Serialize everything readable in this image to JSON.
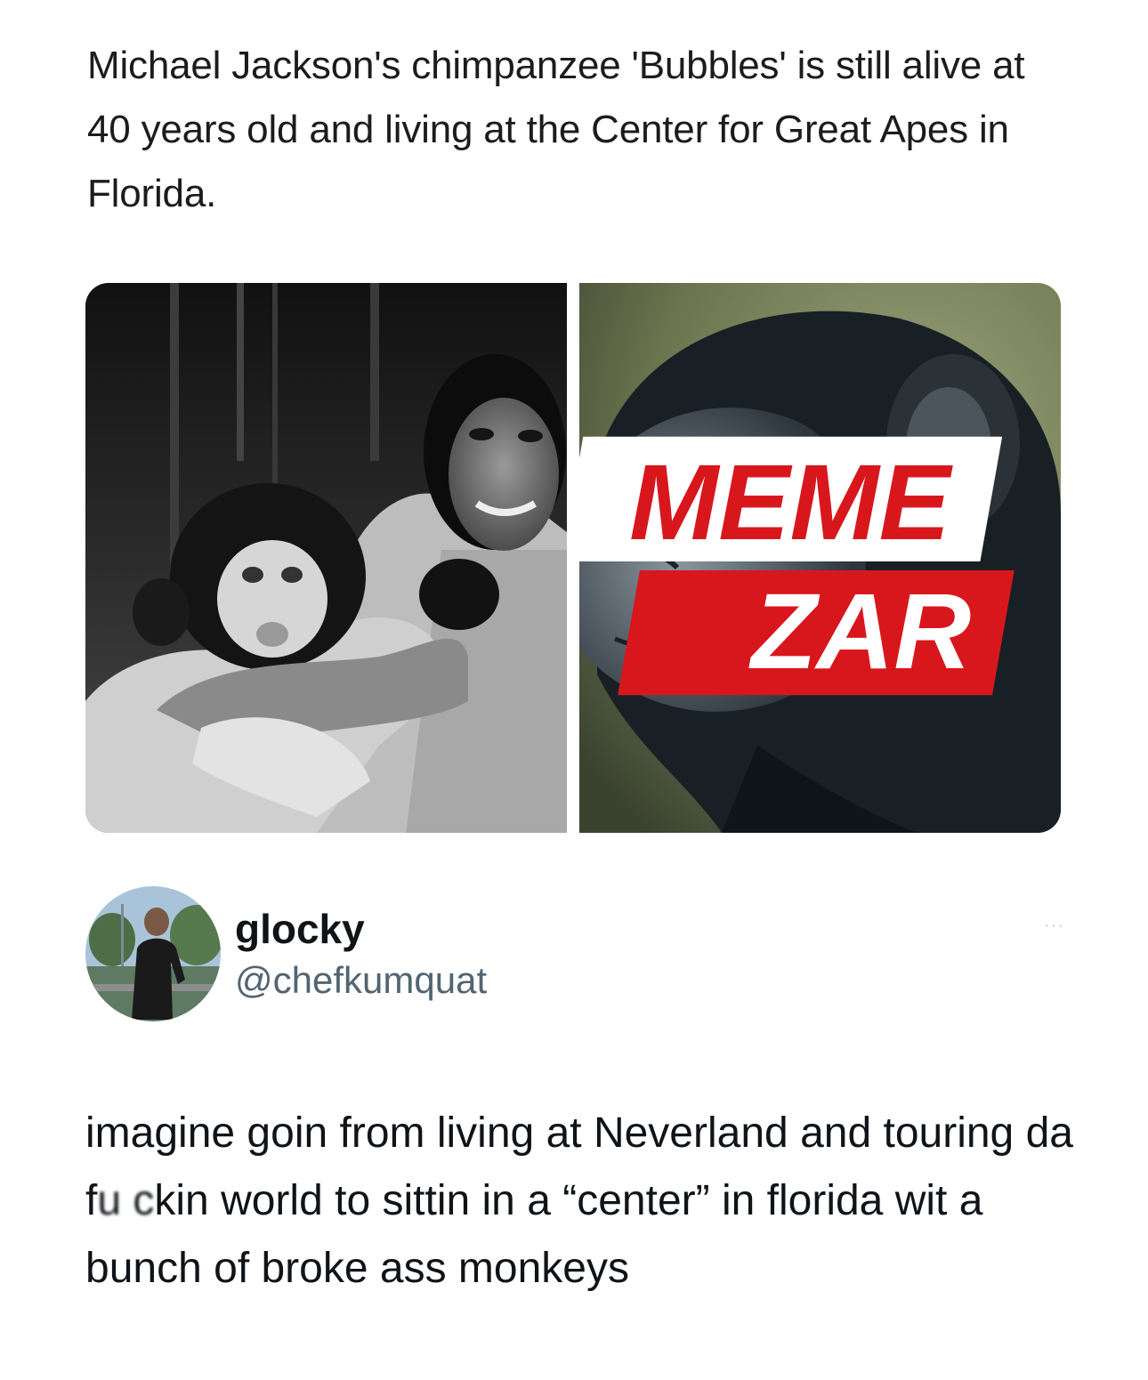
{
  "post": {
    "headline": "Michael Jackson's chimpanzee 'Bubbles' is still alive at 40 years old and living at the Center for Great Apes in Florida.",
    "watermark": {
      "line1": "MEME",
      "line2": "ZAR"
    }
  },
  "reply": {
    "display_name": "glocky",
    "handle": "@chefkumquat",
    "more_label": "···",
    "text_before": "imagine goin from living at Neverland and touring da f",
    "text_censored": "u c",
    "text_after": "kin world to sittin in a “center” in florida wit a bunch of broke ass monkeys"
  },
  "colors": {
    "text_primary": "#0f1419",
    "text_secondary": "#536471",
    "watermark_red": "#d8171d"
  }
}
